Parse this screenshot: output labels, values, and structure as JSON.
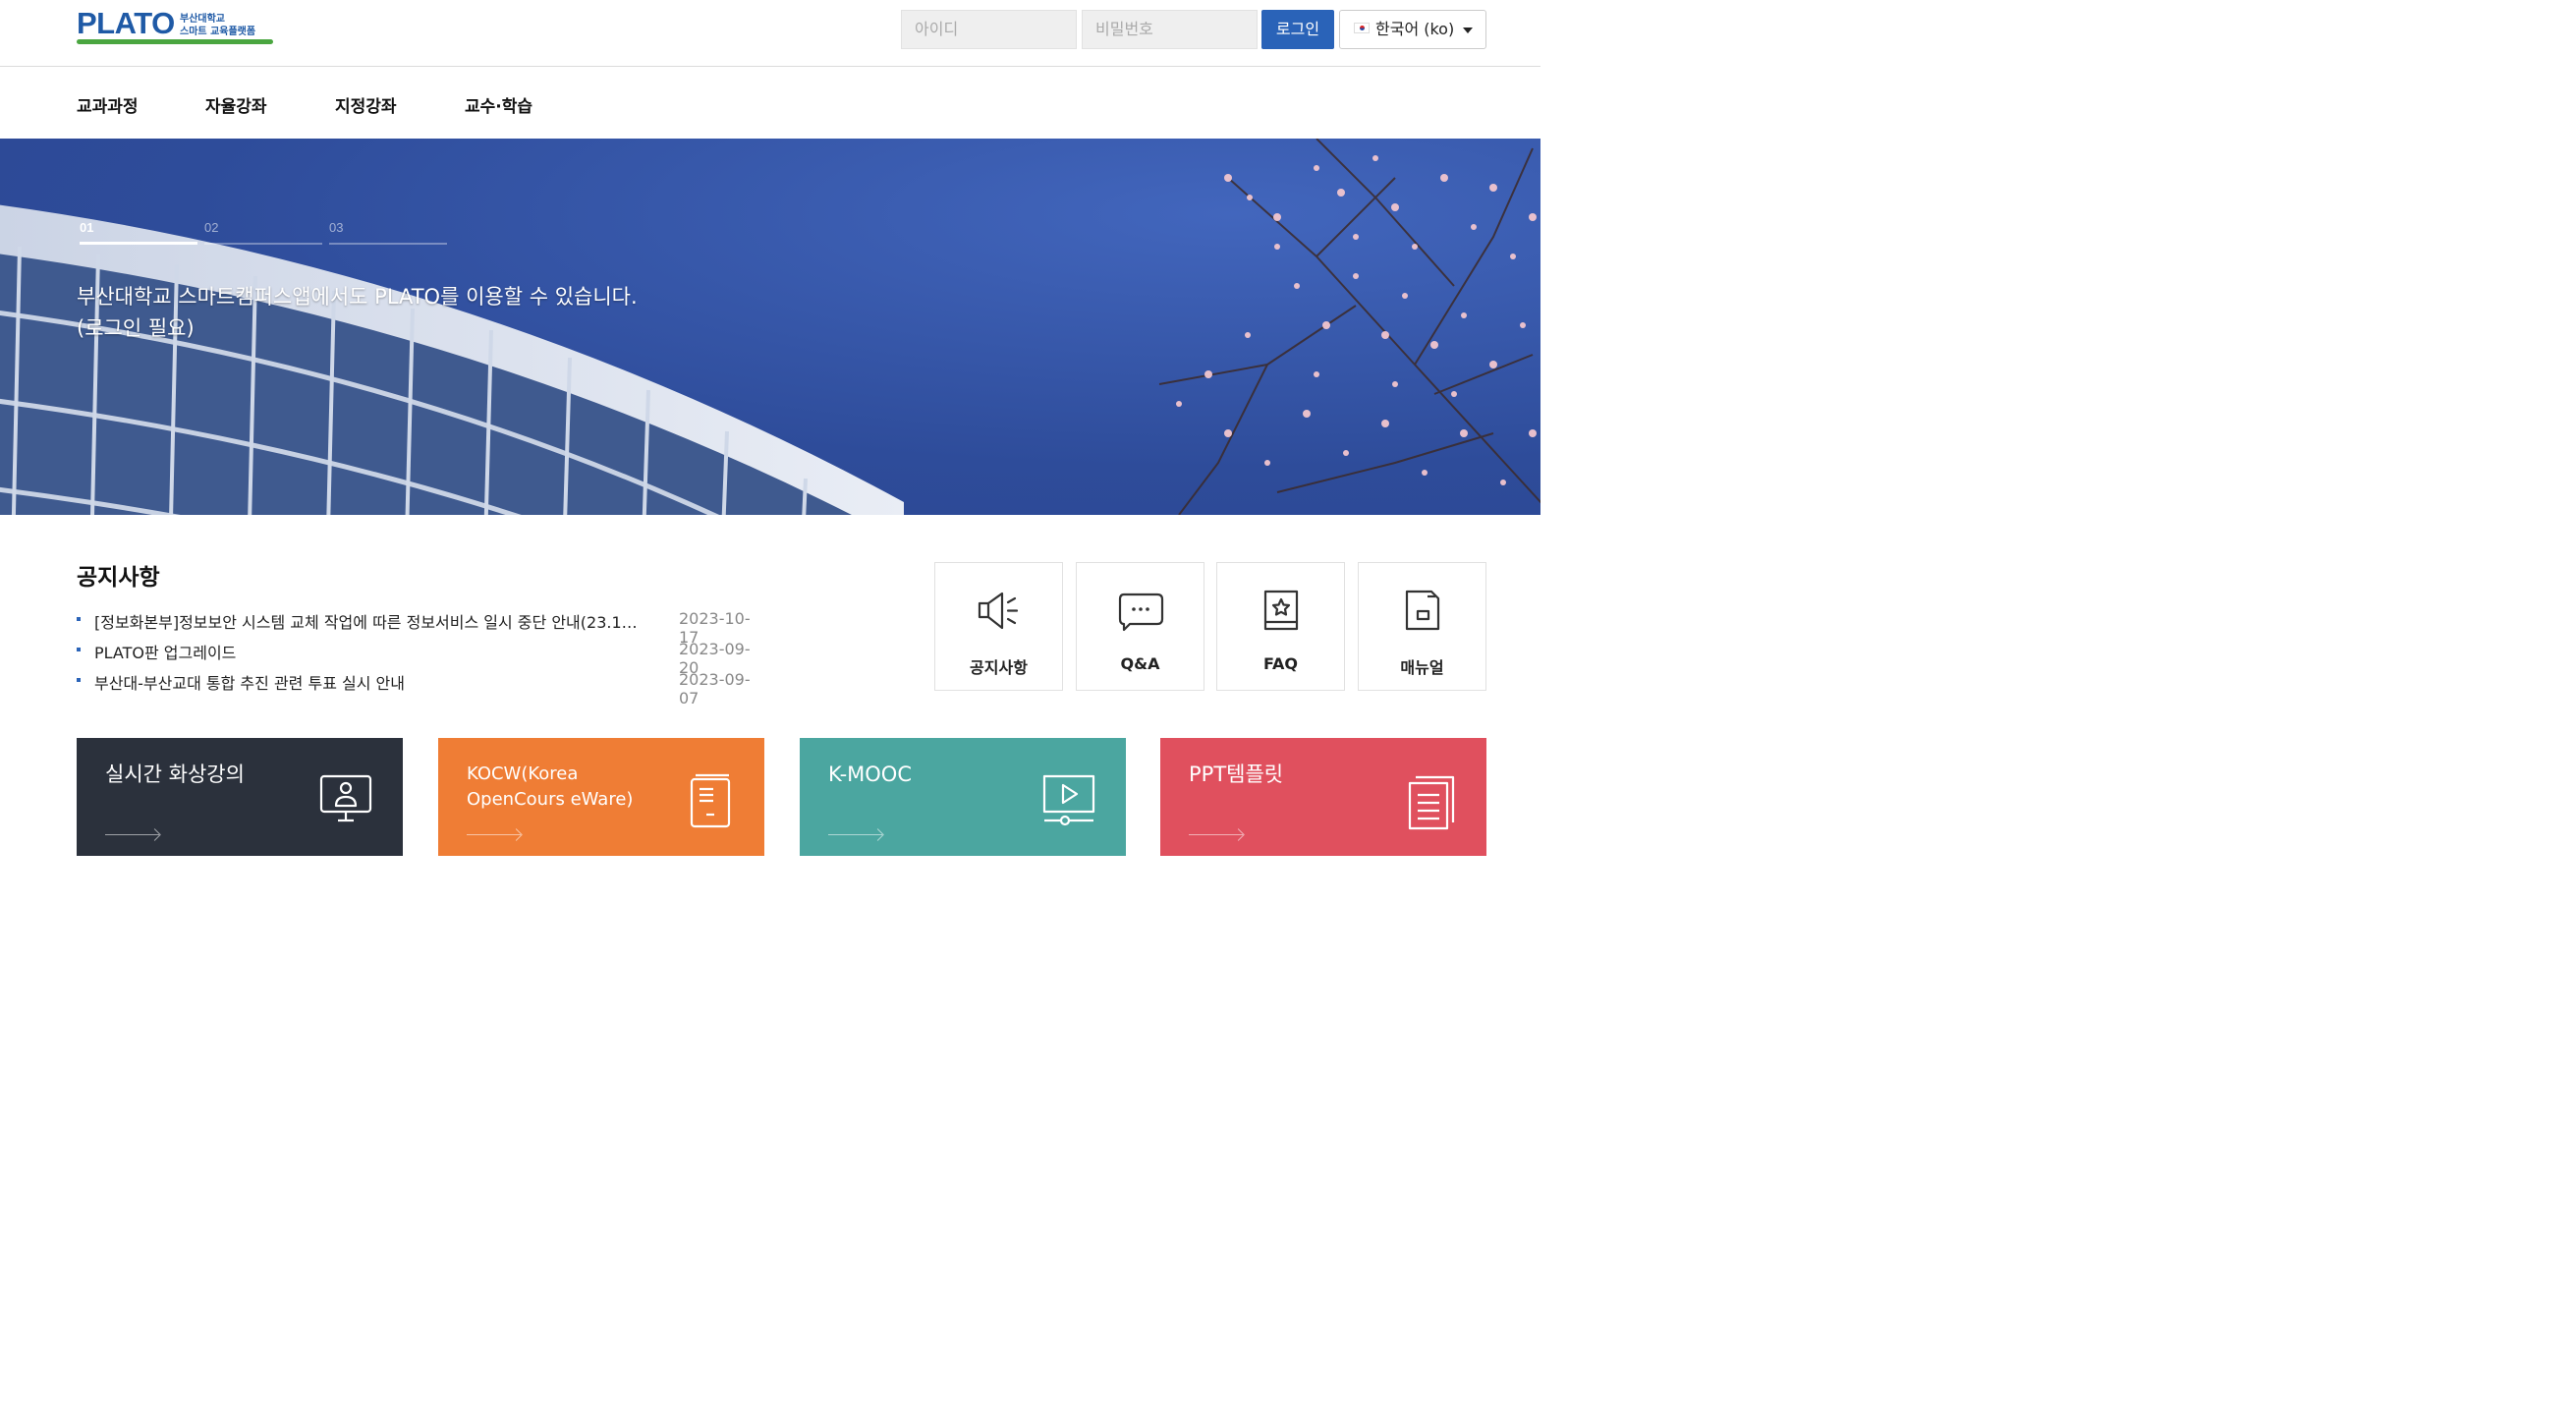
{
  "brand": {
    "logo_text": "PLATO",
    "logo_sub1": "부산대학교",
    "logo_sub2": "스마트 교육플랫폼"
  },
  "login": {
    "id_placeholder": "아이디",
    "pw_placeholder": "비밀번호",
    "button": "로그인",
    "language": "한국어 (ko)"
  },
  "nav": {
    "items": [
      {
        "label": "교과과정"
      },
      {
        "label": "자율강좌"
      },
      {
        "label": "지정강좌"
      },
      {
        "label": "교수·학습"
      }
    ]
  },
  "hero": {
    "slides": [
      "01",
      "02",
      "03"
    ],
    "active_slide": "01",
    "line1": "부산대학교 스마트캠퍼스앱에서도 PLATO를 이용할 수 있습니다.",
    "line2": "(로그인 필요)"
  },
  "notice": {
    "title": "공지사항",
    "items": [
      {
        "title": "[정보화본부]정보보안 시스템 교체 작업에 따른 정보서비스 일시 중단 안내(23.1…",
        "date": "2023-10-17"
      },
      {
        "title": "PLATO판 업그레이드",
        "date": "2023-09-20"
      },
      {
        "title": "부산대-부산교대 통합 추진 관련 투표 실시 안내",
        "date": "2023-09-07"
      }
    ]
  },
  "quick_links": [
    {
      "label": "공지사항",
      "icon": "megaphone-icon"
    },
    {
      "label": "Q&A",
      "icon": "chat-bubble-icon"
    },
    {
      "label": "FAQ",
      "icon": "book-star-icon"
    },
    {
      "label": "매뉴얼",
      "icon": "manual-icon"
    }
  ],
  "cards": [
    {
      "title": "실시간 화상강의",
      "color": "#2b313c",
      "icon": "monitor-user-icon"
    },
    {
      "title": "KOCW(Korea OpenCourseWare)",
      "title_display": "KOCW(Korea OpenCours eWare)",
      "color": "#ef7d35",
      "icon": "document-icon"
    },
    {
      "title": "K-MOOC",
      "color": "#4ba6a0",
      "icon": "video-play-icon"
    },
    {
      "title": "PPT템플릿",
      "color": "#e0505e",
      "icon": "slides-icon"
    }
  ]
}
